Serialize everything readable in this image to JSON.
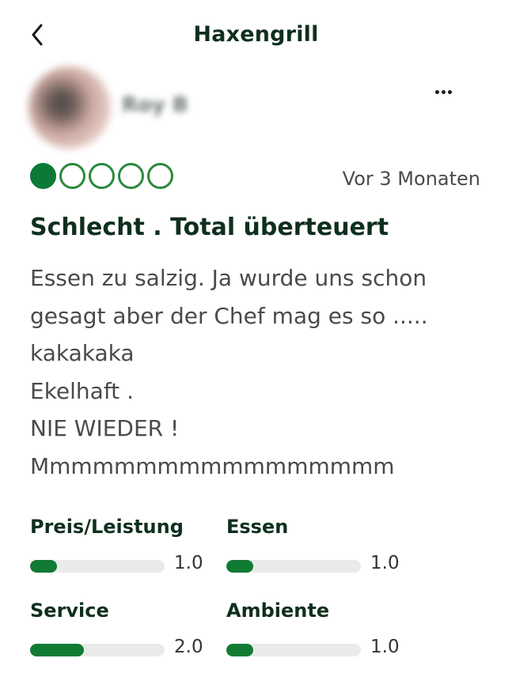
{
  "header": {
    "title": "Haxengrill",
    "back_icon": "chevron-left-icon"
  },
  "review": {
    "user_name": "Roy B",
    "more_icon": "more-horizontal-icon",
    "rating": 1,
    "rating_max": 5,
    "date": "Vor 3 Monaten",
    "headline": "Schlecht . Total überteuert",
    "body_lines": [
      "Essen zu salzig. Ja wurde uns schon",
      "gesagt aber der Chef mag es so .....",
      "kakakaka",
      "Ekelhaft .",
      "NIE WIEDER !",
      "Mmmmmmmmmmmmmmmmm"
    ]
  },
  "subratings": [
    {
      "label": "Preis/Leistung",
      "value": "1.0",
      "fraction": 0.2
    },
    {
      "label": "Essen",
      "value": "1.0",
      "fraction": 0.2
    },
    {
      "label": "Service",
      "value": "2.0",
      "fraction": 0.4
    },
    {
      "label": "Ambiente",
      "value": "1.0",
      "fraction": 0.2
    }
  ],
  "colors": {
    "brand_green": "#0c7a37",
    "title_green": "#0f2f1e",
    "track_gray": "#eaeaea"
  }
}
